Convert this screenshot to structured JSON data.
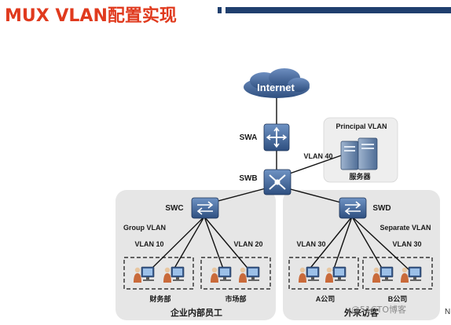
{
  "title": "MUX VLAN配置实现",
  "labels": {
    "internet": "Internet",
    "swa": "SWA",
    "swb": "SWB",
    "swc": "SWC",
    "swd": "SWD",
    "principal_vlan": "Principal VLAN",
    "vlan40": "VLAN 40",
    "server": "服务器",
    "group_vlan": "Group VLAN",
    "separate_vlan": "Separate VLAN",
    "vlan10": "VLAN 10",
    "vlan20": "VLAN 20",
    "vlan30_left": "VLAN 30",
    "vlan30_right": "VLAN 30",
    "finance": "财务部",
    "marketing": "市场部",
    "company_a": "A公司",
    "company_b": "B公司",
    "employees": "企业内部员工",
    "visitors": "外来访客"
  },
  "watermark": "@51CTO博客",
  "edge_letter": "N",
  "colors": {
    "title": "#e03a1e",
    "title_bar": "#1f3f6e",
    "device_blue": "#3b5f8f",
    "region_fill": "#e6e6e6",
    "server_fill": "#eeeeee"
  },
  "icons": [
    "cloud-icon",
    "router-icon",
    "core-switch-icon",
    "switch-icon",
    "server-icon",
    "user-pc-icon"
  ]
}
